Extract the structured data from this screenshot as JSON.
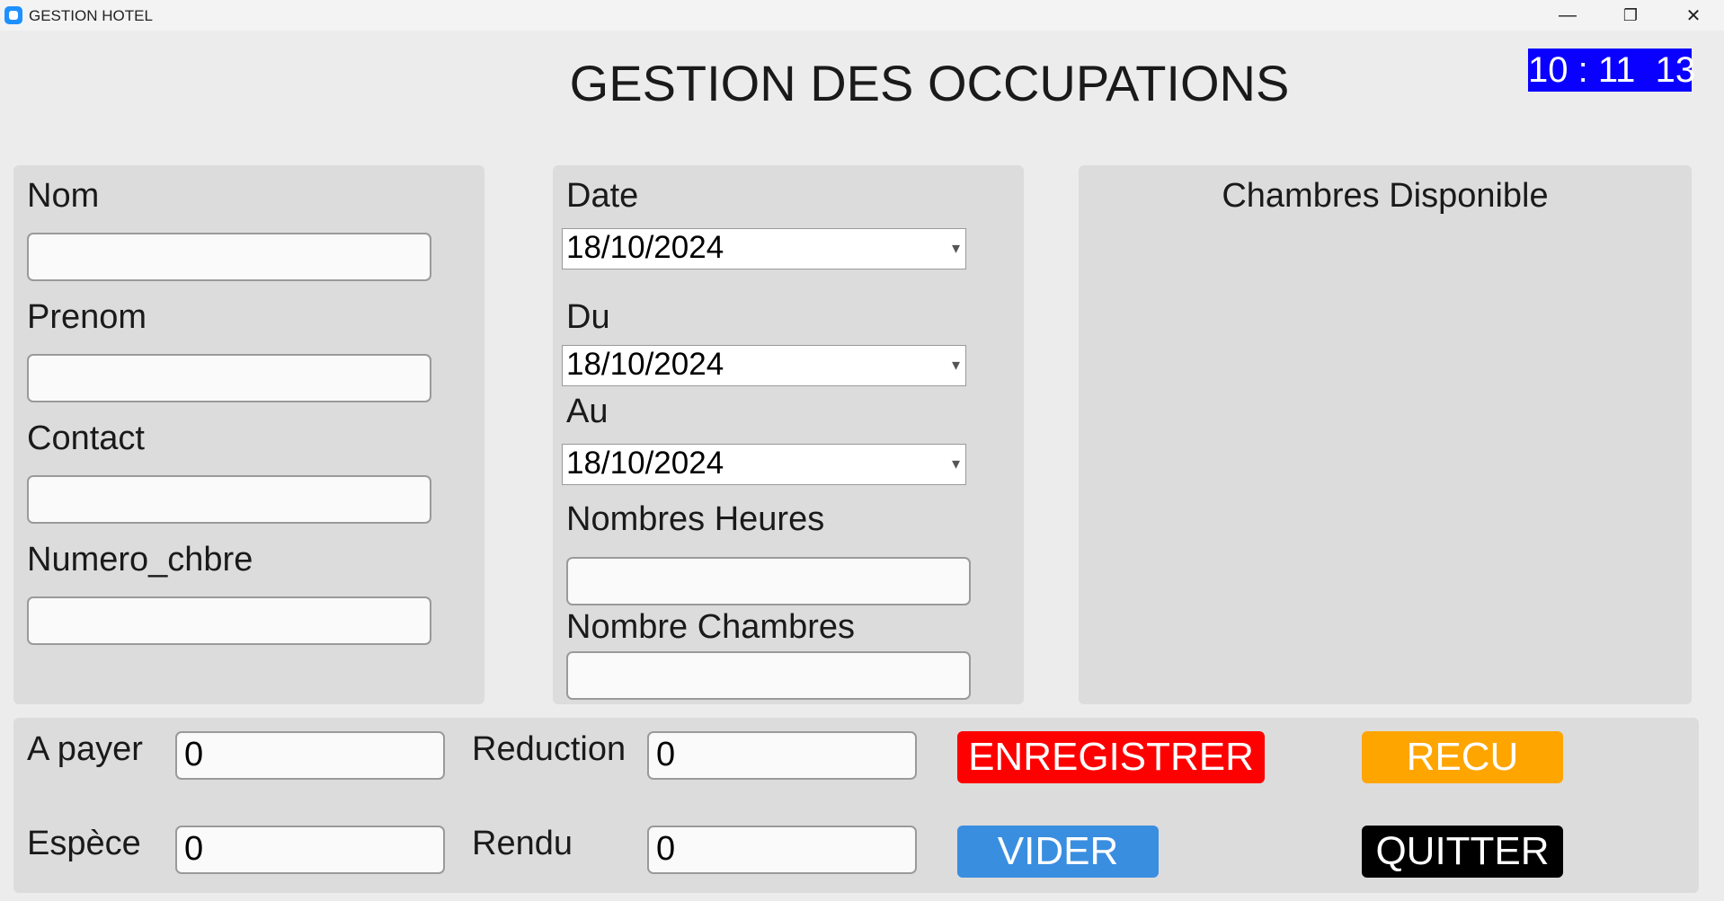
{
  "window": {
    "title": "GESTION HOTEL",
    "minimize": "—",
    "restore": "❐",
    "close": "✕"
  },
  "header": {
    "title": "GESTION DES OCCUPATIONS",
    "clock": "10 : 11  13"
  },
  "client": {
    "nom_label": "Nom",
    "nom_value": "",
    "prenom_label": "Prenom",
    "prenom_value": "",
    "contact_label": "Contact",
    "contact_value": "",
    "numero_label": "Numero_chbre",
    "numero_value": ""
  },
  "dates": {
    "date_label": "Date",
    "date_value": "18/10/2024",
    "du_label": "Du",
    "du_value": "18/10/2024",
    "au_label": "Au",
    "au_value": "18/10/2024",
    "heures_label": "Nombres Heures",
    "heures_value": "",
    "chambres_label": "Nombre Chambres",
    "chambres_value": ""
  },
  "rooms": {
    "title": "Chambres Disponible"
  },
  "payment": {
    "a_payer_label": "A payer",
    "a_payer_value": "0",
    "reduction_label": "Reduction",
    "reduction_value": "0",
    "espece_label": "Espèce",
    "espece_value": "0",
    "rendu_label": "Rendu",
    "rendu_value": "0"
  },
  "buttons": {
    "enregistrer": "ENREGISTRER",
    "recu": "RECU",
    "vider": "VIDER",
    "quitter": "QUITTER"
  },
  "colors": {
    "clock_bg": "#0a00ff",
    "enregistrer": "#ff0000",
    "recu": "#ffa500",
    "vider": "#3a8ee0",
    "quitter": "#000000"
  },
  "icons": {
    "dropdown": "▾"
  }
}
